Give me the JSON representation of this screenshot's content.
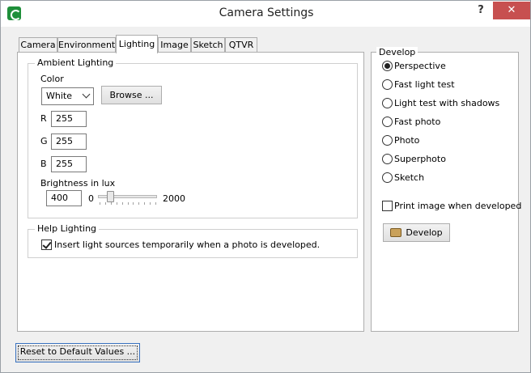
{
  "window": {
    "title": "Camera Settings",
    "help_glyph": "?",
    "close_glyph": "✕"
  },
  "tabs": [
    {
      "label": "Camera"
    },
    {
      "label": "Environment"
    },
    {
      "label": "Lighting"
    },
    {
      "label": "Image"
    },
    {
      "label": "Sketch"
    },
    {
      "label": "QTVR"
    }
  ],
  "active_tab": "Lighting",
  "ambient": {
    "legend": "Ambient Lighting",
    "color_label": "Color",
    "color_value": "White",
    "browse_label": "Browse ...",
    "r_label": "R",
    "r_value": "255",
    "g_label": "G",
    "g_value": "255",
    "b_label": "B",
    "b_value": "255",
    "brightness_label": "Brightness in lux",
    "brightness_value": "400",
    "slider_min": "0",
    "slider_max": "2000",
    "slider_level": 0.2
  },
  "help_lighting": {
    "legend": "Help Lighting",
    "checkbox_label": "Insert light sources temporarily when a photo is developed.",
    "checked": true
  },
  "develop": {
    "legend": "Develop",
    "options": [
      {
        "label": "Perspective",
        "selected": true
      },
      {
        "label": "Fast light test",
        "selected": false
      },
      {
        "label": "Light test with shadows",
        "selected": false
      },
      {
        "label": "Fast photo",
        "selected": false
      },
      {
        "label": "Photo",
        "selected": false
      },
      {
        "label": "Superphoto",
        "selected": false
      },
      {
        "label": "Sketch",
        "selected": false
      }
    ],
    "print_label": "Print image when developed",
    "print_checked": false,
    "develop_button": "Develop"
  },
  "footer": {
    "reset_label": "Reset to Default Values ..."
  }
}
